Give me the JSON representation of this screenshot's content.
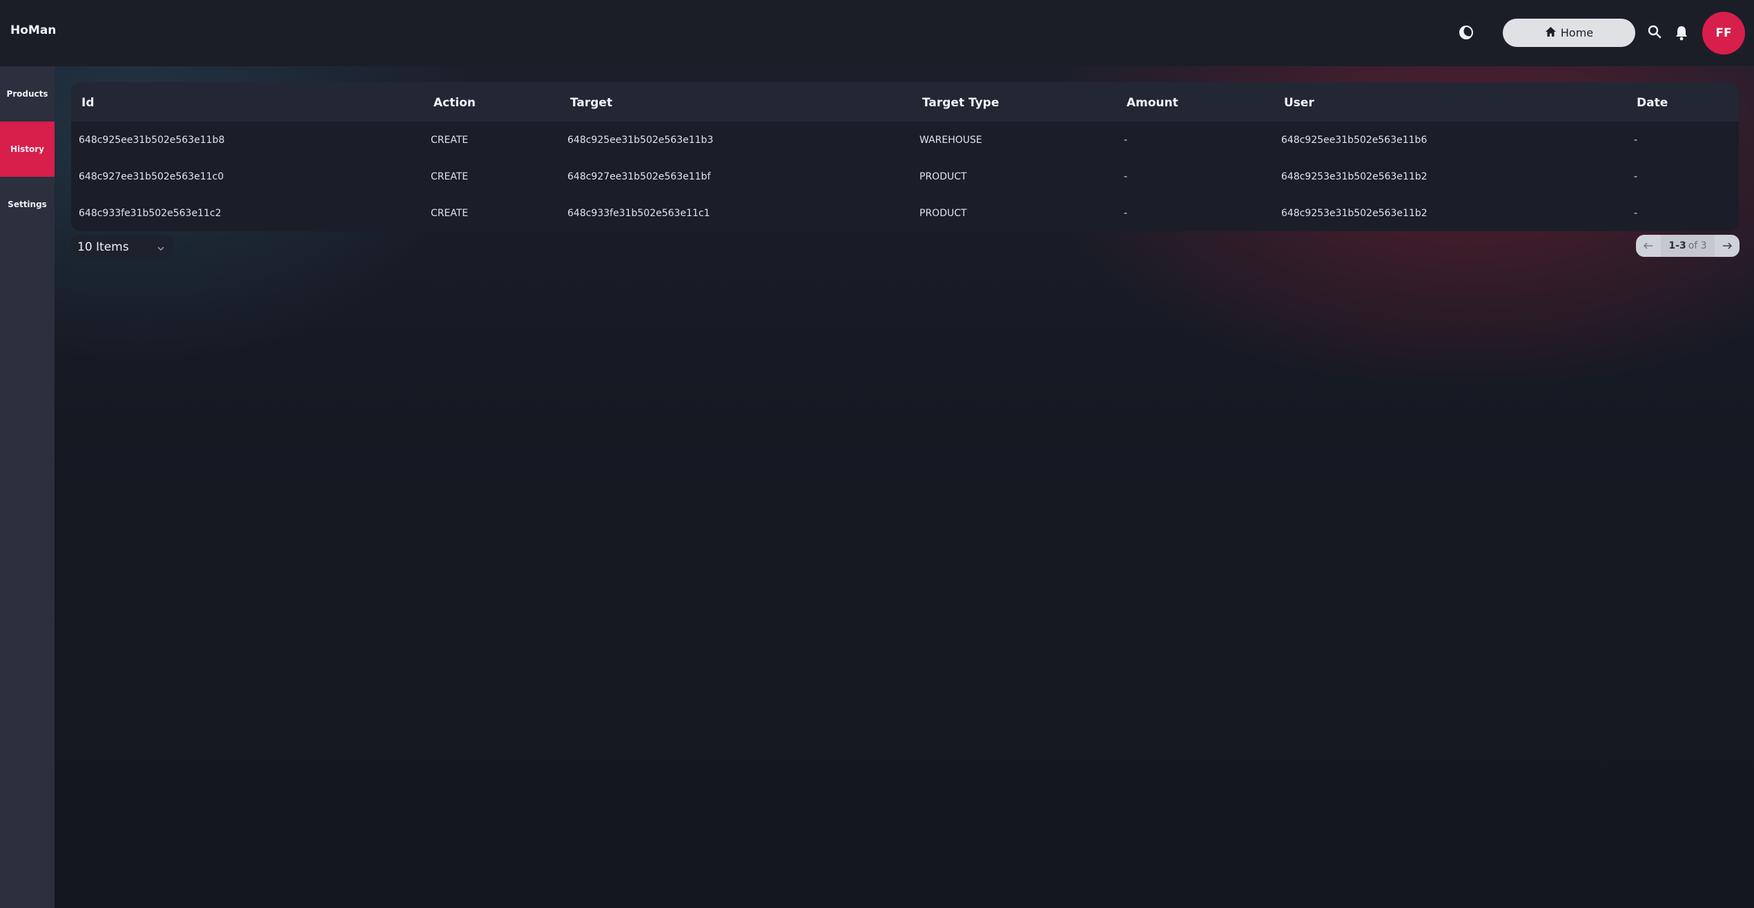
{
  "app": {
    "brand": "HoMan"
  },
  "header": {
    "home_label": "Home",
    "avatar_initials": "FF",
    "icons": [
      "theme-toggle-icon",
      "home-icon",
      "search-icon",
      "bell-icon"
    ]
  },
  "sidebar": {
    "items": [
      {
        "label": "Products",
        "active": false
      },
      {
        "label": "History",
        "active": true
      },
      {
        "label": "Settings",
        "active": false
      }
    ]
  },
  "table": {
    "columns": [
      "Id",
      "Action",
      "Target",
      "Target Type",
      "Amount",
      "User",
      "Date"
    ],
    "rows": [
      [
        "648c925ee31b502e563e11b8",
        "CREATE",
        "648c925ee31b502e563e11b3",
        "WAREHOUSE",
        "-",
        "648c925ee31b502e563e11b6",
        "-"
      ],
      [
        "648c927ee31b502e563e11c0",
        "CREATE",
        "648c927ee31b502e563e11bf",
        "PRODUCT",
        "-",
        "648c9253e31b502e563e11b2",
        "-"
      ],
      [
        "648c933fe31b502e563e11c2",
        "CREATE",
        "648c933fe31b502e563e11c1",
        "PRODUCT",
        "-",
        "648c9253e31b502e563e11b2",
        "-"
      ]
    ]
  },
  "footer": {
    "items_per_page": "10 Items",
    "range": "1-3",
    "of_total": "of 3"
  },
  "colors": {
    "accent": "#d81e4a",
    "topbar": "#1b1e27",
    "sidebar": "#2b2f3e"
  }
}
